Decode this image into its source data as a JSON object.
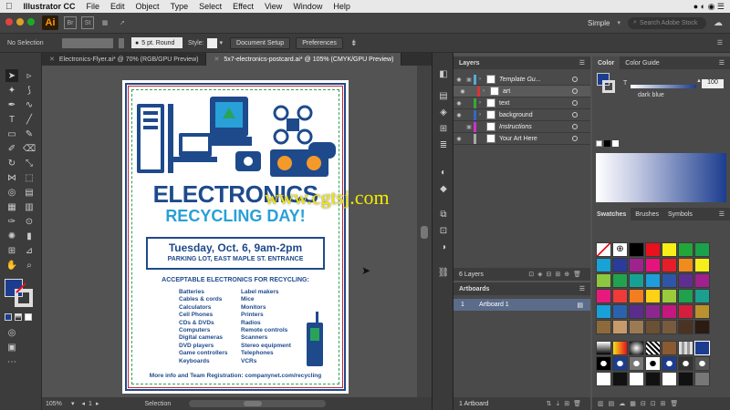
{
  "menubar": {
    "app_name": "Illustrator CC",
    "items": [
      "File",
      "Edit",
      "Object",
      "Type",
      "Select",
      "Effect",
      "View",
      "Window",
      "Help"
    ]
  },
  "appbar": {
    "logo": "Ai",
    "br": "Br",
    "st": "St",
    "workspace": "Simple",
    "search_placeholder": "Search Adobe Stock"
  },
  "control": {
    "selection": "No Selection",
    "stroke": "5 pt. Round",
    "style_label": "Style:",
    "doc_setup": "Document Setup",
    "preferences": "Preferences"
  },
  "tabs": [
    {
      "label": "Electronics-Flyer.ai* @ 70% (RGB/GPU Preview)"
    },
    {
      "label": "5x7-electronics-postcard.ai* @ 105% (CMYK/GPU Preview)"
    }
  ],
  "status": {
    "zoom": "105%",
    "page": "1",
    "tool": "Selection"
  },
  "poster": {
    "title": "ELECTRONICS",
    "subtitle": "RECYCLING DAY!",
    "date": "Tuesday, Oct. 6, 9am-2pm",
    "location": "PARKING LOT, EAST MAPLE ST. ENTRANCE",
    "accept_heading": "ACCEPTABLE ELECTRONICS FOR RECYCLING:",
    "col1": [
      "Batteries",
      "Cables & cords",
      "Calculators",
      "Cell Phones",
      "CDs & DVDs",
      "Computers",
      "Digital cameras",
      "DVD players",
      "Game controllers",
      "Keyboards"
    ],
    "col2": [
      "Label makers",
      "Mice",
      "Monitors",
      "Printers",
      "Radios",
      "Remote controls",
      "Scanners",
      "Stereo equipment",
      "Telephones",
      "VCRs"
    ],
    "footer": "More info and Team Registration: companynet.com/recycling"
  },
  "watermark": "www.cgtsj.com",
  "layers": {
    "title": "Layers",
    "rows": [
      {
        "name": "Template Gu...",
        "color": "#5ad",
        "italic": true
      },
      {
        "name": "art",
        "color": "#d33",
        "italic": false
      },
      {
        "name": "text",
        "color": "#3a3",
        "italic": false
      },
      {
        "name": "background",
        "color": "#36c",
        "italic": false
      },
      {
        "name": "Instructions",
        "color": "#c3c",
        "italic": true
      },
      {
        "name": "Your Art Here",
        "color": "#aaa",
        "italic": false
      }
    ],
    "count": "6 Layers"
  },
  "artboards": {
    "title": "Artboards",
    "num": "1",
    "name": "Artboard 1",
    "count": "1 Artboard"
  },
  "color": {
    "tab1": "Color",
    "tab2": "Color Guide",
    "t_label": "T",
    "value": "100",
    "swatch_name": "dark blue",
    "dark_blue": "#1c3d8f"
  },
  "swatches": {
    "tab1": "Swatches",
    "tab2": "Brushes",
    "tab3": "Symbols",
    "colors": [
      "#ffffff",
      "#ffffff",
      "#000000",
      "#e8111c",
      "#f7ef16",
      "#22a63a",
      "#1aa24a",
      "#17a2d8",
      "#2a3b9b",
      "#a0228f",
      "#e5137c",
      "#e61e2a",
      "#f08c1d",
      "#f6ee1a",
      "#8dc63f",
      "#22a24e",
      "#17a195",
      "#1d9edb",
      "#2f56a6",
      "#5e2e91",
      "#a0218d",
      "#e8197d",
      "#ee3b39",
      "#f47d20",
      "#fcd116",
      "#9bca3b",
      "#20a14b",
      "#1b9f8f",
      "#19a0d8",
      "#2b62ae",
      "#5b2c8e",
      "#8d2790",
      "#c6177e",
      "#d31f3e",
      "#b9912e",
      "#8d6a3c",
      "#c79a6a",
      "#9b7a54",
      "#6b5033",
      "#7a5a3e",
      "#4b3323",
      "#2a1c12",
      "#ffffff",
      "#e4e4e4",
      "#c8c8c8",
      "#a8a8a8",
      "#878787",
      "#6a6a6a",
      "#4c4c4c"
    ]
  }
}
